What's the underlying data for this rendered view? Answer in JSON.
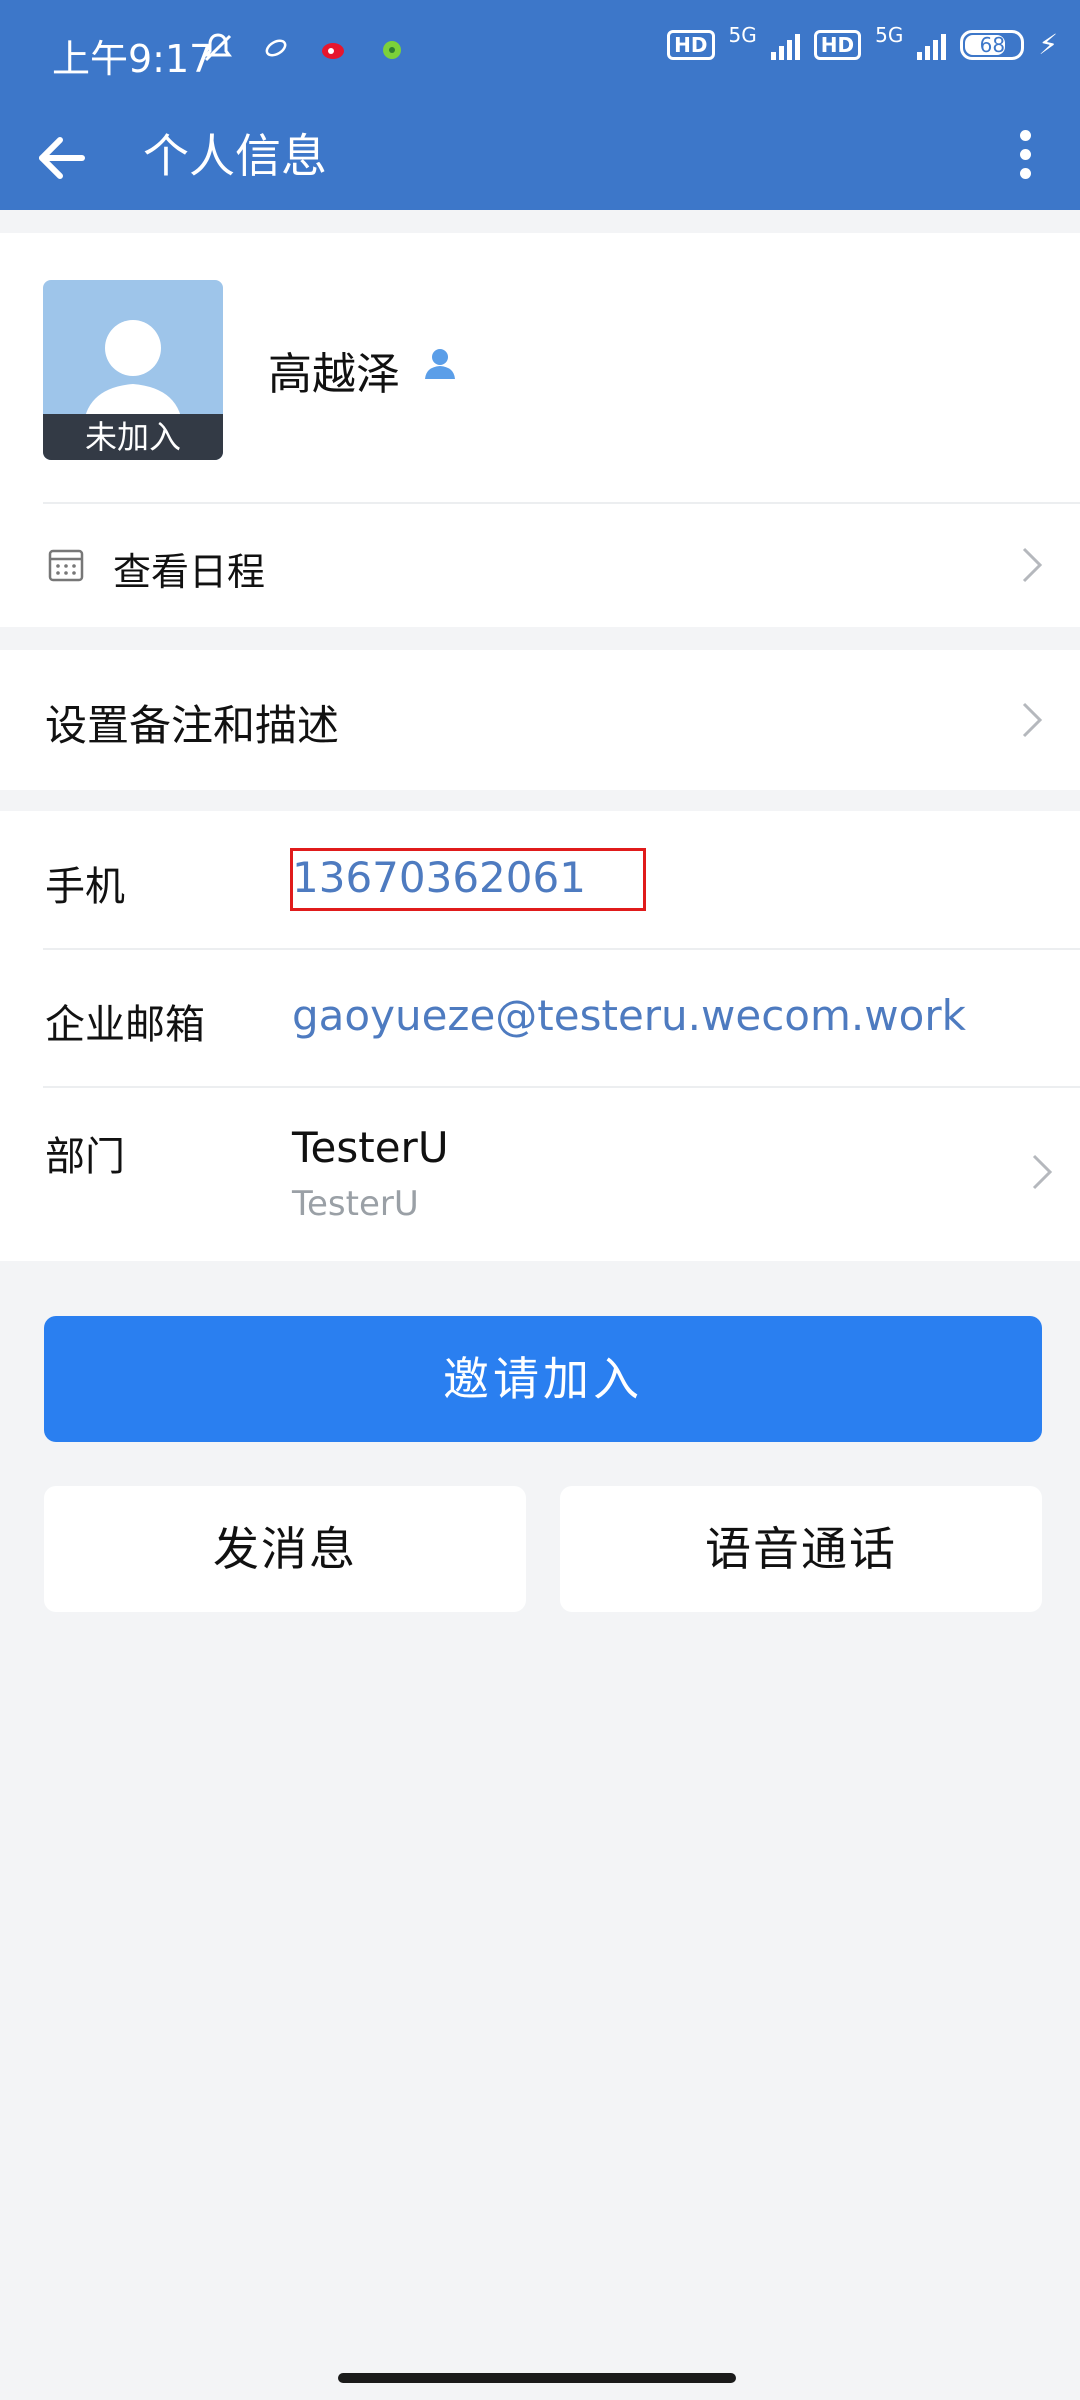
{
  "status_bar": {
    "time": "上午9:17",
    "network_1": "5G",
    "network_2": "5G",
    "hd_label": "HD",
    "battery": "68"
  },
  "nav": {
    "title": "个人信息"
  },
  "profile": {
    "name": "高越泽",
    "avatar_badge": "未加入",
    "schedule_label": "查看日程"
  },
  "remark": {
    "label": "设置备注和描述"
  },
  "info": {
    "phone_label": "手机",
    "phone_value": "13670362061",
    "email_label": "企业邮箱",
    "email_value": "gaoyueze@testeru.wecom.work",
    "dept_label": "部门",
    "dept_value": "TesterU",
    "dept_sub": "TesterU"
  },
  "actions": {
    "invite": "邀请加入",
    "message": "发消息",
    "voice_call": "语音通话"
  },
  "colors": {
    "header": "#3d77c9",
    "primary_button": "#2a7ff0",
    "link_text": "#4e7bc0",
    "highlight_box": "#e01b1b",
    "background": "#f3f4f6"
  }
}
